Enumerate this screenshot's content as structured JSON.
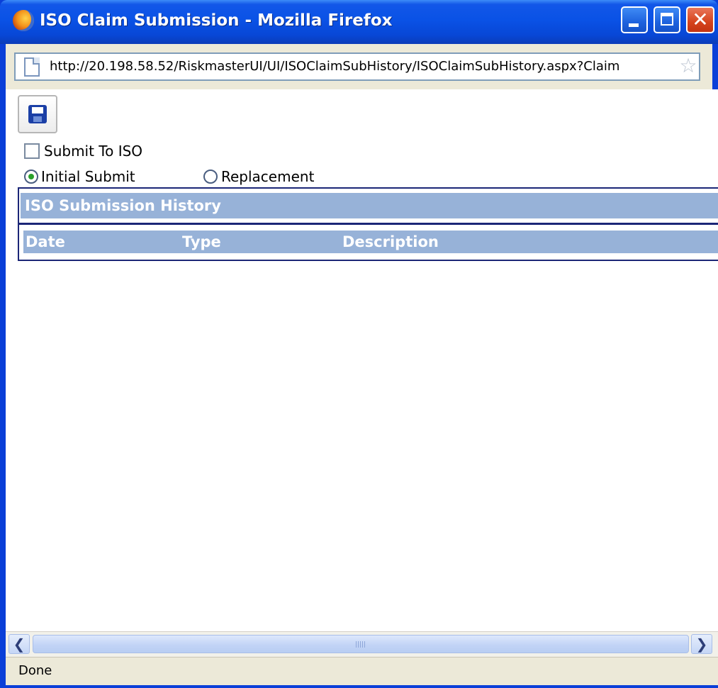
{
  "window": {
    "title": "ISO Claim Submission - Mozilla Firefox",
    "minimize_icon": "minimize-icon",
    "maximize_icon": "maximize-icon",
    "close_icon": "close-icon",
    "close_glyph": "✕"
  },
  "address": {
    "url": "http://20.198.58.52/RiskmasterUI/UI/ISOClaimSubHistory/ISOClaimSubHistory.aspx?Claim",
    "page_icon": "page-icon",
    "star_icon": "bookmark-star-icon",
    "star_glyph": "☆"
  },
  "toolbar": {
    "save_icon": "save-disk-icon"
  },
  "form": {
    "submit_to_iso_label": "Submit To ISO",
    "submit_to_iso_checked": false,
    "submit_type_options": [
      "Initial Submit",
      "Replacement"
    ],
    "submit_type_selected": "Initial Submit"
  },
  "history": {
    "title": "ISO Submission History",
    "columns": [
      "Date",
      "Type",
      "Description"
    ],
    "rows": []
  },
  "scrollbar": {
    "left_glyph": "❮",
    "right_glyph": "❯"
  },
  "status": {
    "text": "Done"
  },
  "colors": {
    "title_bar": "#0a52e6",
    "panel_header": "#97b2d8",
    "panel_border": "#1b2677",
    "chrome": "#ece9d8"
  }
}
